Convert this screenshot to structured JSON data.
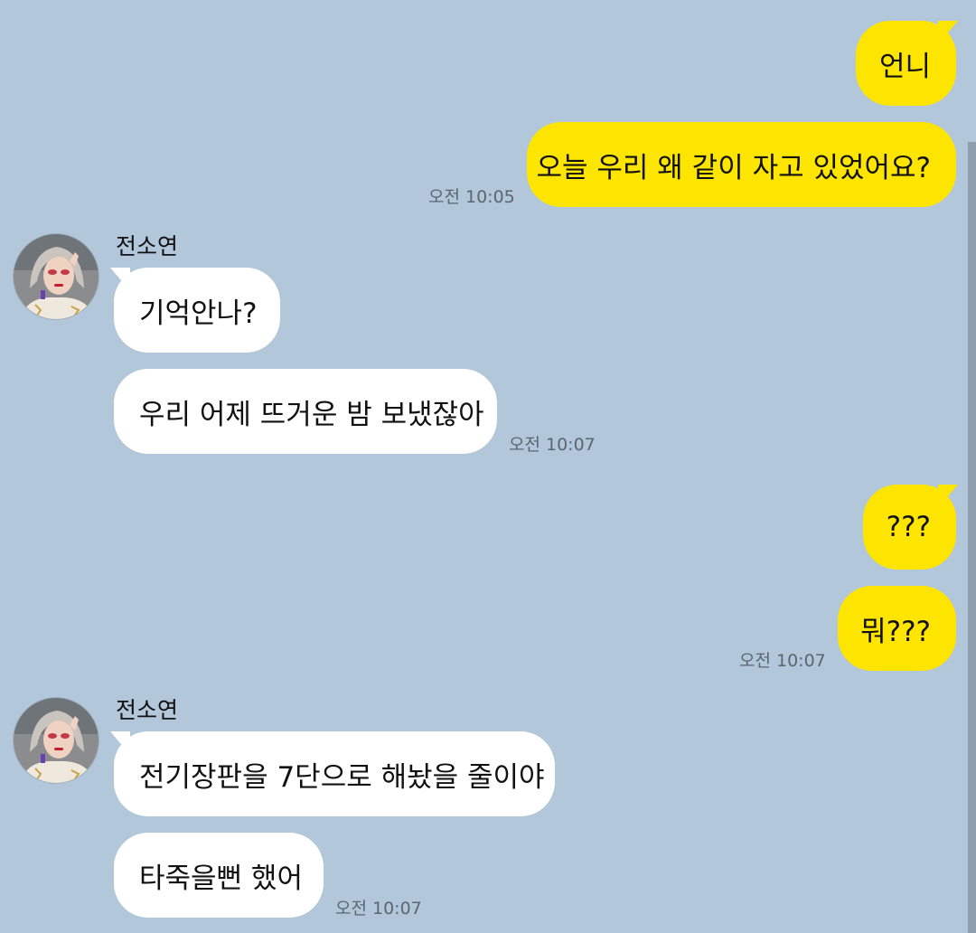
{
  "chat": {
    "colors": {
      "background": "#b2c7da",
      "my_bubble": "#fee500",
      "other_bubble": "#ffffff"
    },
    "messages": [
      {
        "sender": "me",
        "text": "언니"
      },
      {
        "sender": "me",
        "text": "오늘 우리 왜 같이 자고 있었어요?",
        "time": "오전 10:05"
      },
      {
        "sender": "other",
        "name": "전소연",
        "text": "기억안나?"
      },
      {
        "sender": "other",
        "text": "우리 어제 뜨거운 밤 보냈잖아",
        "time": "오전 10:07"
      },
      {
        "sender": "me",
        "text": "???"
      },
      {
        "sender": "me",
        "text": "뭐???",
        "time": "오전 10:07"
      },
      {
        "sender": "other",
        "name": "전소연",
        "text": "전기장판을 7단으로 해놨을 줄이야"
      },
      {
        "sender": "other",
        "text": "타죽을뻔 했어",
        "time": "오전 10:07"
      }
    ]
  }
}
